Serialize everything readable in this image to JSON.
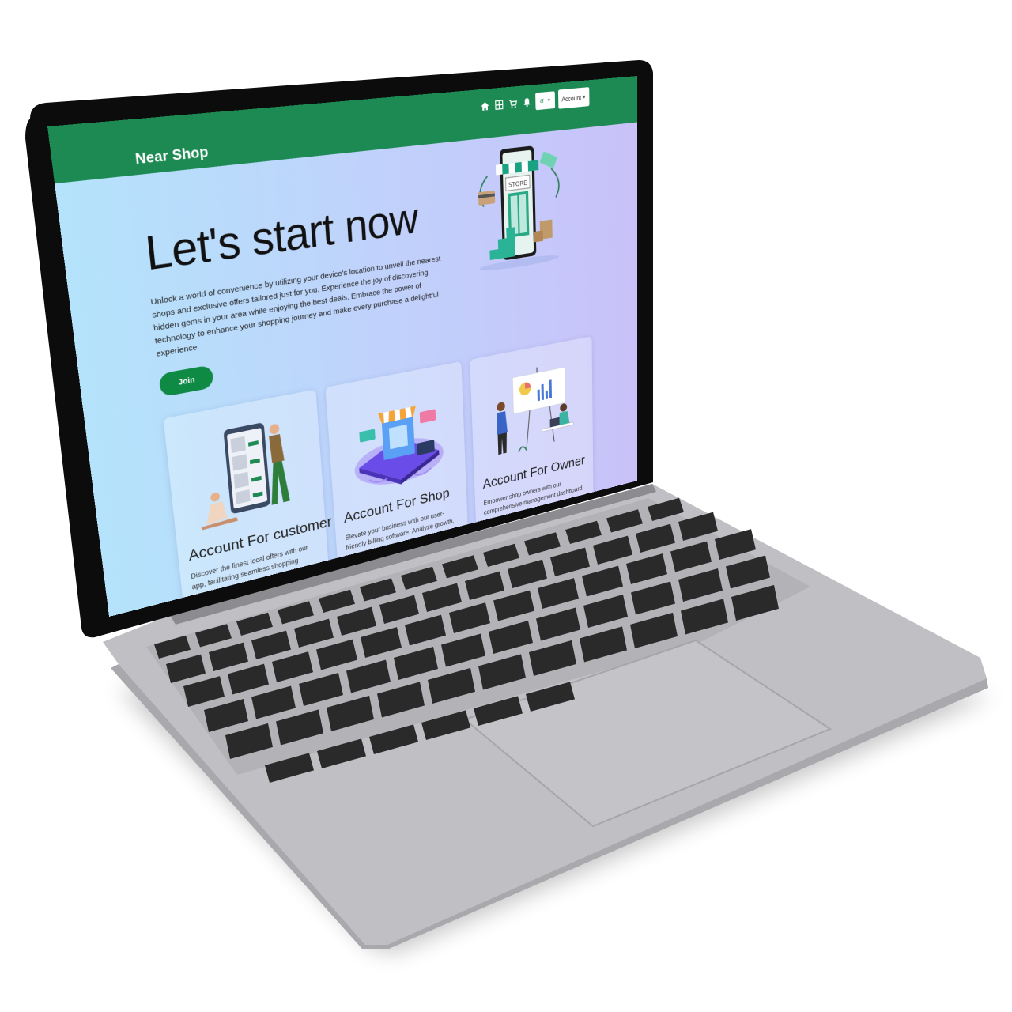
{
  "app": {
    "brand": "Near Shop"
  },
  "nav": {
    "icons": [
      "home-icon",
      "grid-icon",
      "cart-icon",
      "bell-icon"
    ],
    "language_icon": "language-icon",
    "account_label": "Account"
  },
  "hero": {
    "title": "Let's start now",
    "text": "Unlock a world of convenience by utilizing your device's location to unveil the nearest shops and exclusive offers tailored just for you. Experience the joy of discovering hidden gems in your area while enjoying the best deals. Embrace the power of technology to enhance your shopping journey and make every purchase a delightful experience.",
    "join_label": "Join",
    "illustration_label": "STORE"
  },
  "cards": [
    {
      "title": "Account For customer",
      "text": "Discover the finest local offers with our app, facilitating seamless shopping experiences. Compare prices, order effortlessly, and enjoy"
    },
    {
      "title": "Account For Shop",
      "text": "Elevate your business with our user-friendly billing software. Analyze growth, export insightful reports, manage orders efficiently, and craft enticing offers"
    },
    {
      "title": "Account For Owner",
      "text": "Empower shop owners with our comprehensive management dashboard. Take control, analyze shop performance, and efficiently manage multiple"
    }
  ],
  "colors": {
    "brand_green": "#1c8a52",
    "button_green": "#0f8a45",
    "laptop_body": "#c0bfc3",
    "keycap": "#2a2a2a",
    "bezel": "#0c0c0c"
  }
}
